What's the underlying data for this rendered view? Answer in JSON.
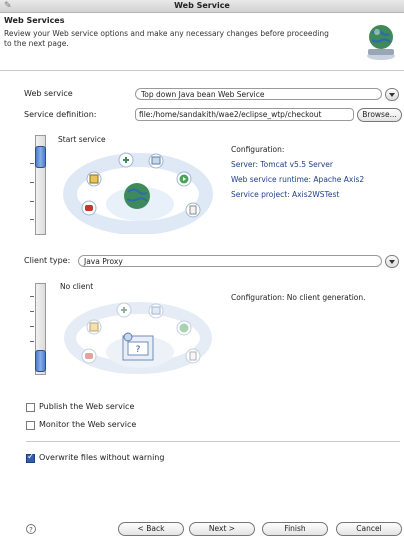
{
  "window": {
    "title": "Web Service"
  },
  "header": {
    "title": "Web Services",
    "description": "Review your Web service options and make any necessary changes before proceeding to the next page."
  },
  "form": {
    "web_service_label": "Web service",
    "web_service_value": "Top down Java bean Web Service",
    "service_definition_label": "Service definition:",
    "service_definition_value": "file:/home/sandakith/wae2/eclipse_wtp/checkout",
    "browse_label": "Browse...",
    "client_type_label": "Client type:",
    "client_type_value": "Java Proxy"
  },
  "service_panel": {
    "slider_label": "Start service",
    "config_heading": "Configuration:",
    "config_server": "Server: Tomcat v5.5 Server",
    "config_runtime": "Web service runtime: Apache Axis2",
    "config_project": "Service project: Axis2WSTest"
  },
  "client_panel": {
    "slider_label": "No client",
    "config_heading": "Configuration: No client generation."
  },
  "options": {
    "publish_label": "Publish the Web service",
    "publish_checked": false,
    "monitor_label": "Monitor the Web service",
    "monitor_checked": false,
    "overwrite_label": "Overwrite files without warning",
    "overwrite_checked": true
  },
  "footer": {
    "help_glyph": "?",
    "back_label": "< Back",
    "next_label": "Next >",
    "finish_label": "Finish",
    "cancel_label": "Cancel"
  },
  "colors": {
    "accent": "#2f5db0",
    "link_text": "#1f3f8a",
    "diagram_arc": "#dfe9f6"
  },
  "icons": [
    "window-icon",
    "web-service-banner-icon",
    "dropdown-arrow-icon",
    "help-icon",
    "globe-icon",
    "check-icon"
  ]
}
